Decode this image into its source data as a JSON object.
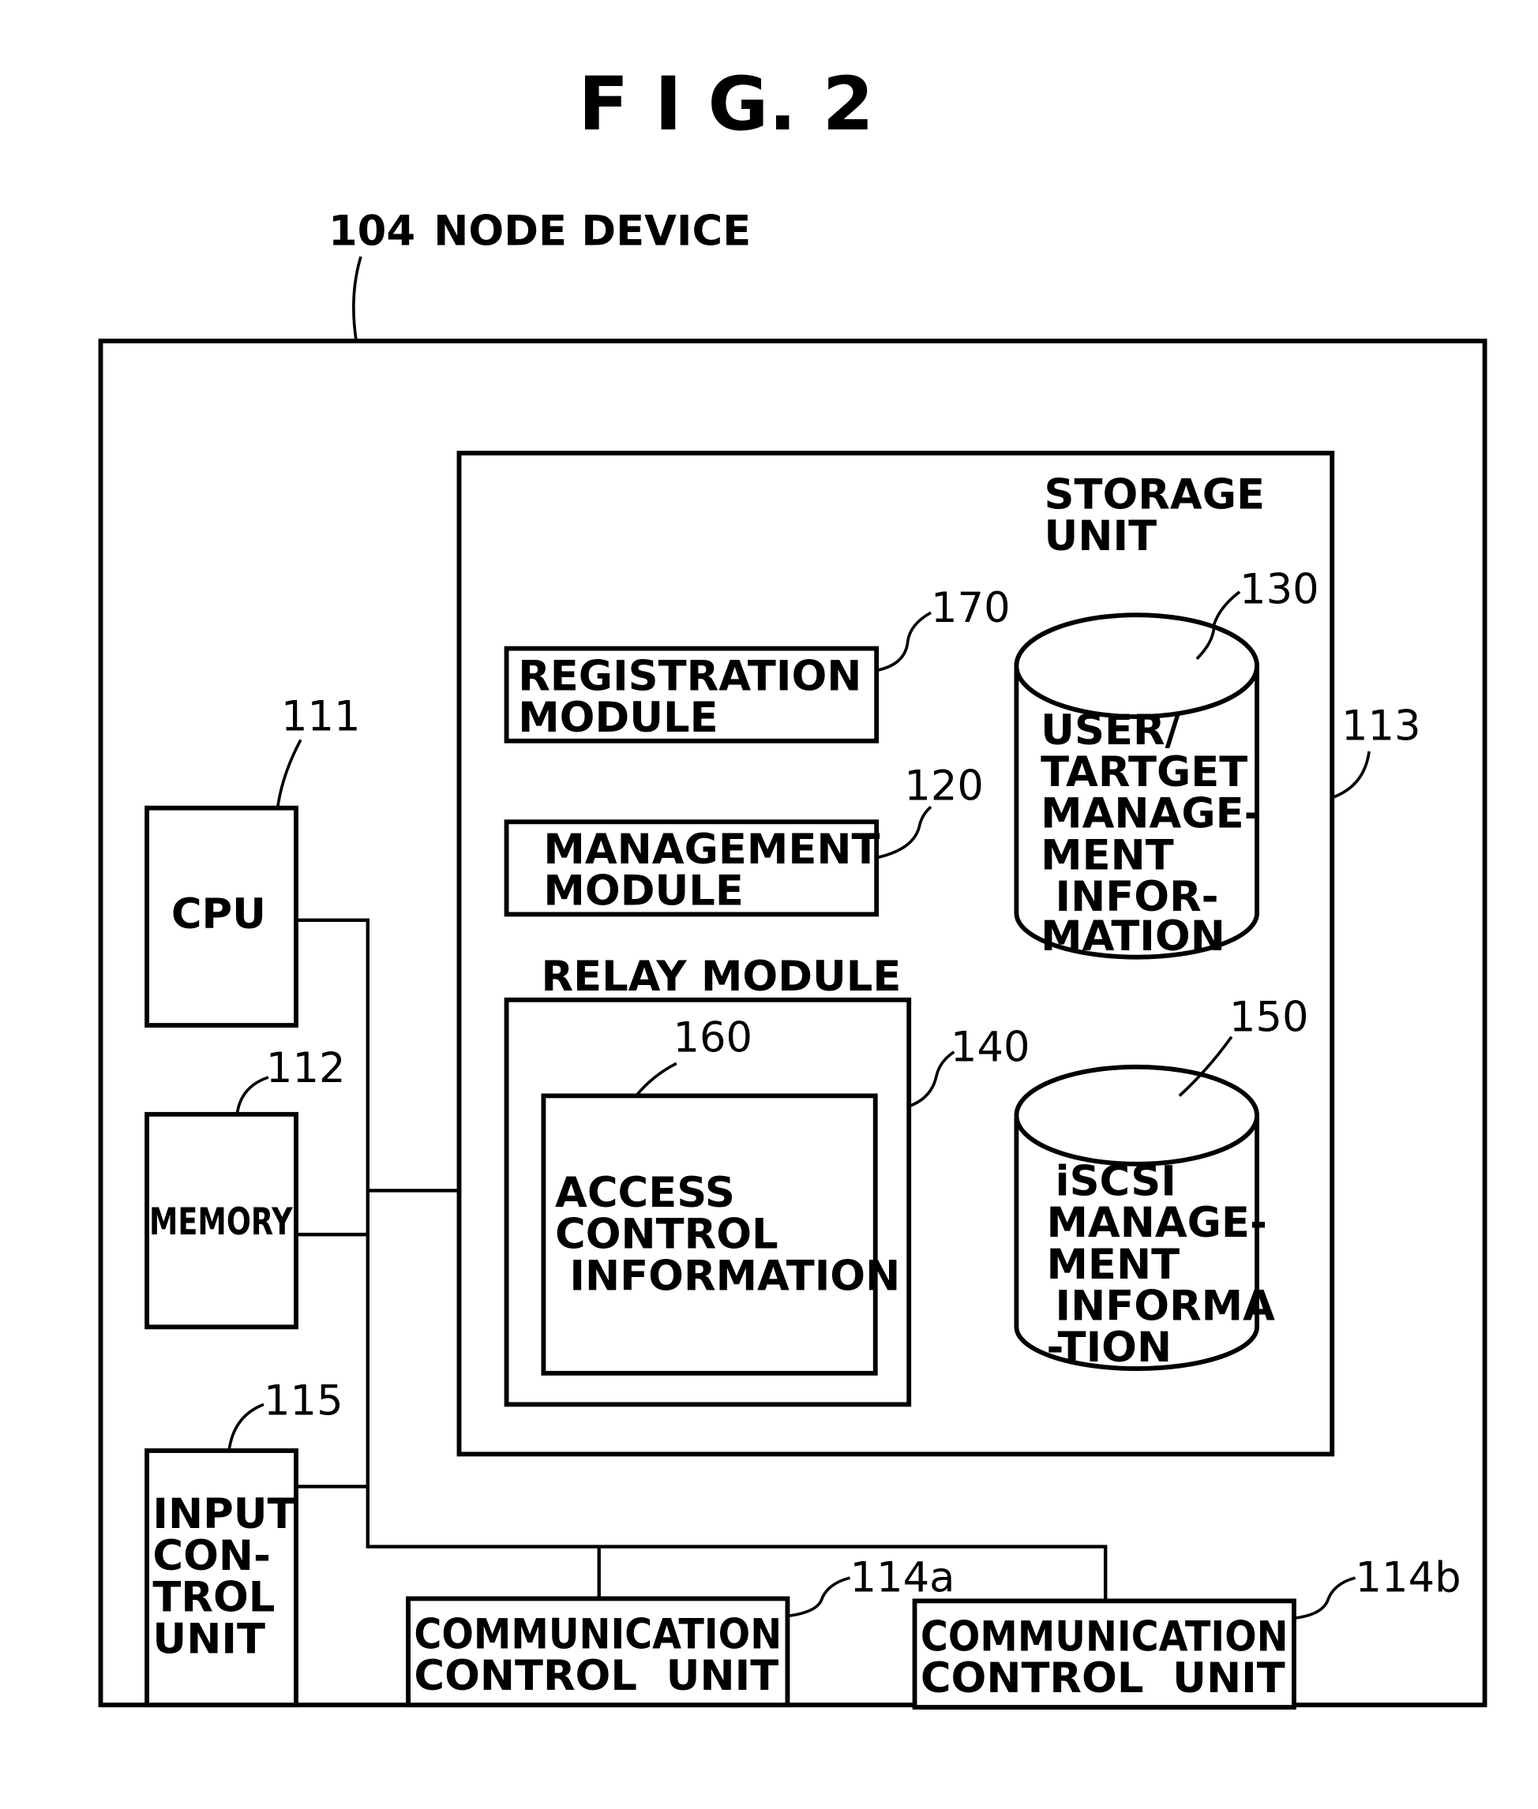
{
  "figure": {
    "title": "F I G. 2",
    "node_device": {
      "ref": "104",
      "label": "NODE DEVICE"
    }
  },
  "components": {
    "cpu": {
      "ref": "111",
      "lines": [
        "CPU"
      ]
    },
    "memory": {
      "ref": "112",
      "lines": [
        "MEMORY"
      ]
    },
    "storage_unit": {
      "ref": "113",
      "lines": [
        "STORAGE",
        "UNIT"
      ]
    },
    "comm_a": {
      "ref": "114a",
      "lines": [
        "COMMUNICATION",
        "CONTROL  UNIT"
      ]
    },
    "comm_b": {
      "ref": "114b",
      "lines": [
        "COMMUNICATION",
        "CONTROL  UNIT"
      ]
    },
    "input_control": {
      "ref": "115",
      "lines": [
        "INPUT",
        "CON-",
        "TROL",
        "UNIT"
      ]
    },
    "management_module": {
      "ref": "120",
      "lines": [
        "MANAGEMENT",
        "MODULE"
      ]
    },
    "user_target_db": {
      "ref": "130",
      "lines": [
        "USER/",
        "TARTGET",
        "MANAGE-",
        "MENT",
        " INFOR-",
        "MATION"
      ]
    },
    "relay_module": {
      "ref": "140",
      "lines": [
        "RELAY  MODULE"
      ]
    },
    "iscsi_db": {
      "ref": "150",
      "lines": [
        " iSCSI",
        "MANAGE-",
        "MENT",
        " INFORMA",
        "-TION"
      ]
    },
    "access_control": {
      "ref": "160",
      "lines": [
        "ACCESS",
        "CONTROL",
        " INFORMATION"
      ]
    },
    "registration_module": {
      "ref": "170",
      "lines": [
        "REGISTRATION",
        "MODULE"
      ]
    }
  }
}
